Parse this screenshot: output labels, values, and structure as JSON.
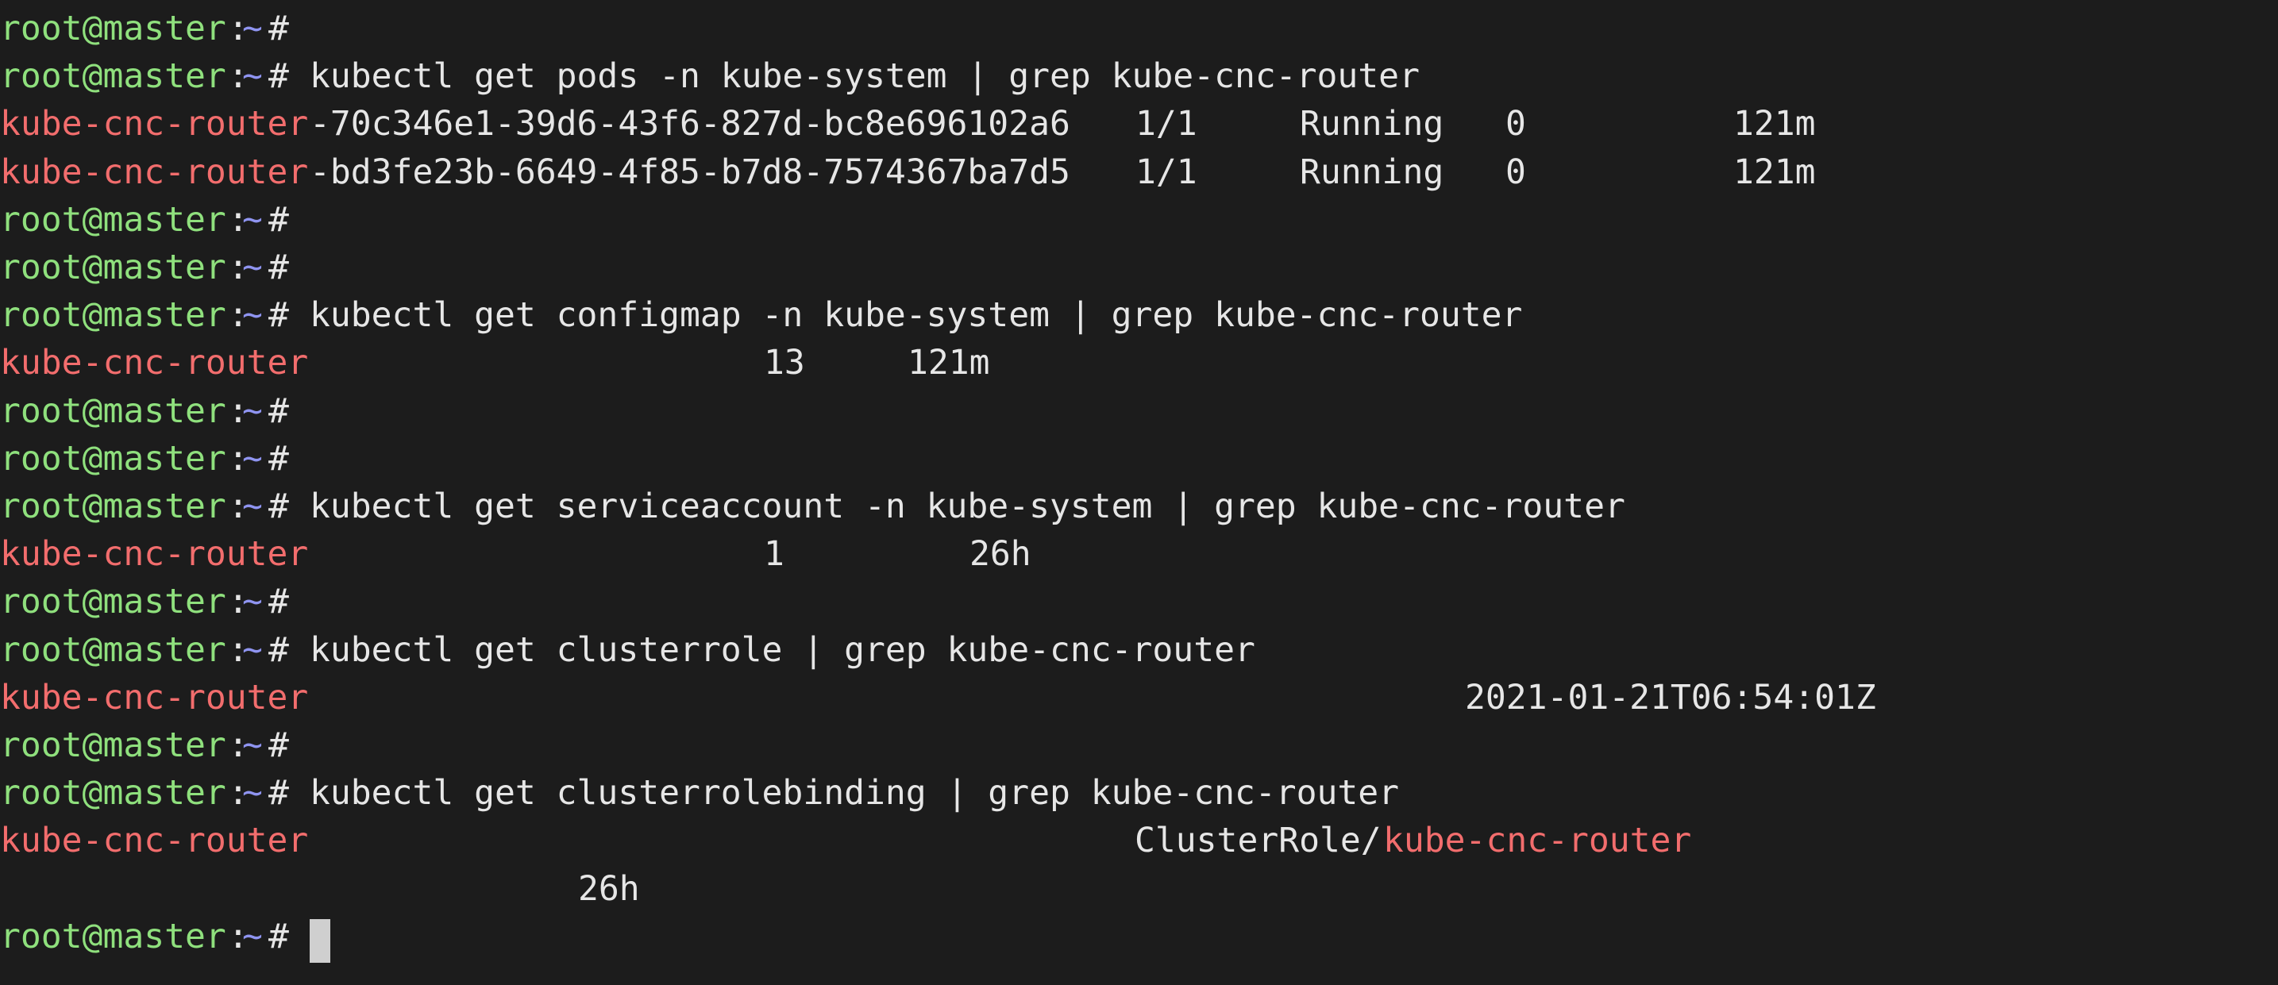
{
  "colors": {
    "background": "#1c1c1c",
    "prompt_user": "#8fe07d",
    "prompt_path": "#8f94f0",
    "match_highlight": "#f26d6d",
    "text": "#e6e6e6",
    "cursor": "#cfcfcf"
  },
  "lines": [
    {
      "type": "prompt",
      "user": "root@master",
      "sep": ":",
      "path": "~",
      "symbol": "#",
      "command": ""
    },
    {
      "type": "prompt",
      "user": "root@master",
      "sep": ":",
      "path": "~",
      "symbol": "#",
      "command": "kubectl get pods -n kube-system | grep kube-cnc-router"
    },
    {
      "type": "output",
      "segments": [
        {
          "text": "kube-cnc-router",
          "color": "red"
        },
        {
          "text": "-70c346e1-39d6-43f6-827d-bc8e696102a6",
          "color": "white"
        },
        {
          "text": "1/1",
          "color": "white"
        },
        {
          "text": "Running",
          "color": "white"
        },
        {
          "text": "0",
          "color": "white"
        },
        {
          "text": "121m",
          "color": "white"
        }
      ]
    },
    {
      "type": "output",
      "segments": [
        {
          "text": "kube-cnc-router",
          "color": "red"
        },
        {
          "text": "-bd3fe23b-6649-4f85-b7d8-7574367ba7d5",
          "color": "white"
        },
        {
          "text": "1/1",
          "color": "white"
        },
        {
          "text": "Running",
          "color": "white"
        },
        {
          "text": "0",
          "color": "white"
        },
        {
          "text": "121m",
          "color": "white"
        }
      ]
    },
    {
      "type": "prompt",
      "user": "root@master",
      "sep": ":",
      "path": "~",
      "symbol": "#",
      "command": ""
    },
    {
      "type": "prompt",
      "user": "root@master",
      "sep": ":",
      "path": "~",
      "symbol": "#",
      "command": ""
    },
    {
      "type": "prompt",
      "user": "root@master",
      "sep": ":",
      "path": "~",
      "symbol": "#",
      "command": "kubectl get configmap -n kube-system | grep kube-cnc-router"
    },
    {
      "type": "output",
      "segments": [
        {
          "text": "kube-cnc-router",
          "color": "red"
        },
        {
          "text": "13",
          "color": "white"
        },
        {
          "text": "121m",
          "color": "white"
        }
      ]
    },
    {
      "type": "prompt",
      "user": "root@master",
      "sep": ":",
      "path": "~",
      "symbol": "#",
      "command": ""
    },
    {
      "type": "prompt",
      "user": "root@master",
      "sep": ":",
      "path": "~",
      "symbol": "#",
      "command": ""
    },
    {
      "type": "prompt",
      "user": "root@master",
      "sep": ":",
      "path": "~",
      "symbol": "#",
      "command": "kubectl get serviceaccount -n kube-system | grep kube-cnc-router"
    },
    {
      "type": "output",
      "segments": [
        {
          "text": "kube-cnc-router",
          "color": "red"
        },
        {
          "text": "1",
          "color": "white"
        },
        {
          "text": "26h",
          "color": "white"
        }
      ]
    },
    {
      "type": "prompt",
      "user": "root@master",
      "sep": ":",
      "path": "~",
      "symbol": "#",
      "command": ""
    },
    {
      "type": "prompt",
      "user": "root@master",
      "sep": ":",
      "path": "~",
      "symbol": "#",
      "command": "kubectl get clusterrole | grep kube-cnc-router"
    },
    {
      "type": "output",
      "segments": [
        {
          "text": "kube-cnc-router",
          "color": "red"
        },
        {
          "text": "2021-01-21T06:54:01Z",
          "color": "white"
        }
      ]
    },
    {
      "type": "prompt",
      "user": "root@master",
      "sep": ":",
      "path": "~",
      "symbol": "#",
      "command": ""
    },
    {
      "type": "prompt",
      "user": "root@master",
      "sep": ":",
      "path": "~",
      "symbol": "#",
      "command": "kubectl get clusterrolebinding | grep kube-cnc-router"
    },
    {
      "type": "output",
      "segments": [
        {
          "text": "kube-cnc-router",
          "color": "red"
        },
        {
          "text": "ClusterRole/",
          "color": "white"
        },
        {
          "text": "kube-cnc-router",
          "color": "red"
        }
      ]
    },
    {
      "type": "output",
      "segments": [
        {
          "text": "26h",
          "color": "white"
        }
      ]
    },
    {
      "type": "prompt",
      "user": "root@master",
      "sep": ":",
      "path": "~",
      "symbol": "#",
      "command": "",
      "cursor": true
    }
  ]
}
